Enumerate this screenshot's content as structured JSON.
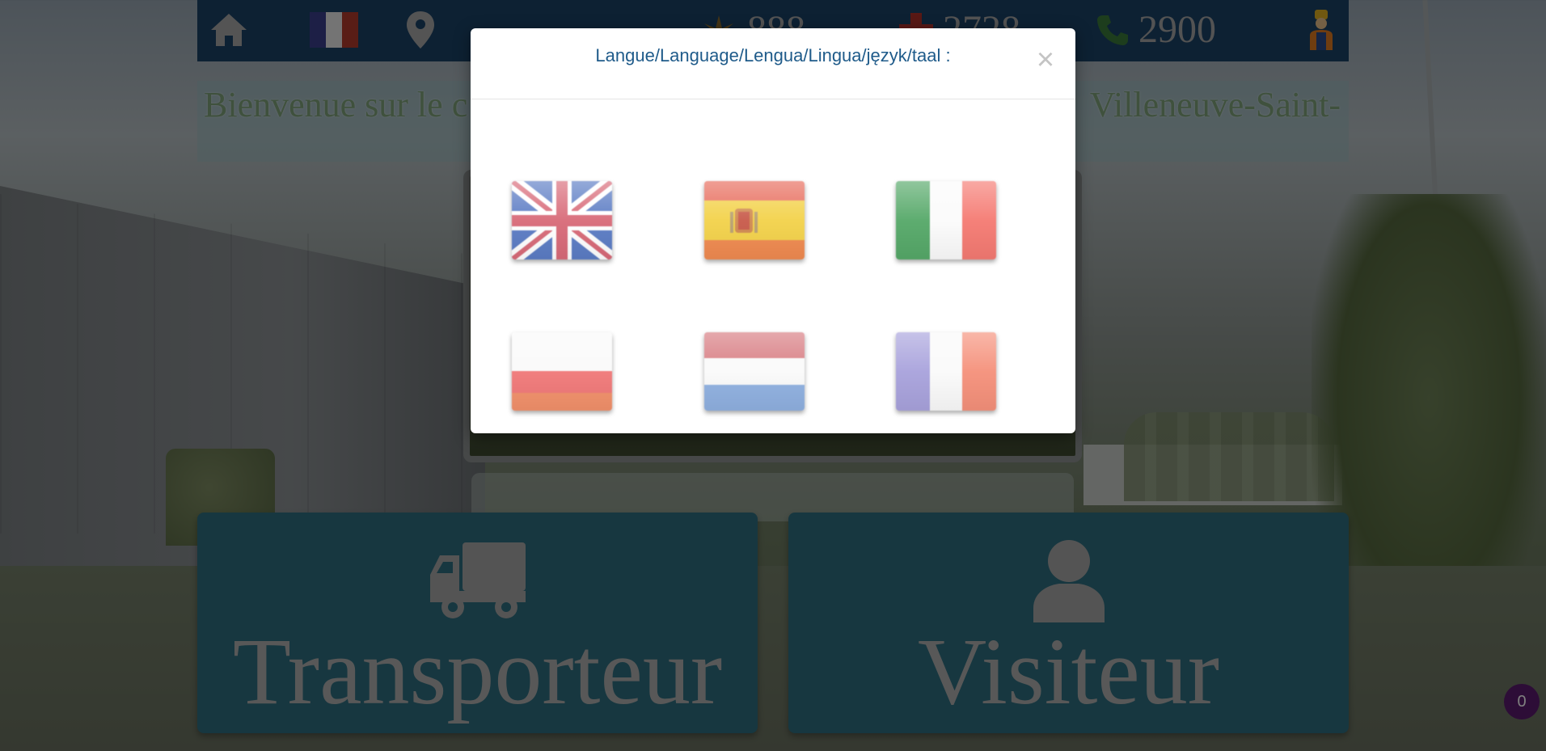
{
  "header": {
    "stats": [
      {
        "icon": "windmill-icon",
        "value": "888"
      },
      {
        "icon": "medical-cross-icon",
        "value": "2728"
      },
      {
        "icon": "phone-icon",
        "value": "2900"
      }
    ]
  },
  "welcome": {
    "text_left": "Bienvenue sur le c",
    "text_right": "Villeneuve-Saint-"
  },
  "buttons": {
    "transporteur": "Transporteur",
    "visiteur": "Visiteur"
  },
  "cart": {
    "count": "0"
  },
  "modal": {
    "title": "Langue/Language/Lengua/Lingua/język/taal :",
    "close": "×",
    "flags": [
      {
        "name": "flag-uk"
      },
      {
        "name": "flag-spain"
      },
      {
        "name": "flag-italy"
      },
      {
        "name": "flag-poland"
      },
      {
        "name": "flag-netherlands"
      },
      {
        "name": "flag-france"
      }
    ]
  },
  "colors": {
    "header_bg": "#1b4266",
    "button_bg": "#2f6e80",
    "modal_title": "#1f5b8a",
    "cart_badge": "#5a1a6e"
  }
}
